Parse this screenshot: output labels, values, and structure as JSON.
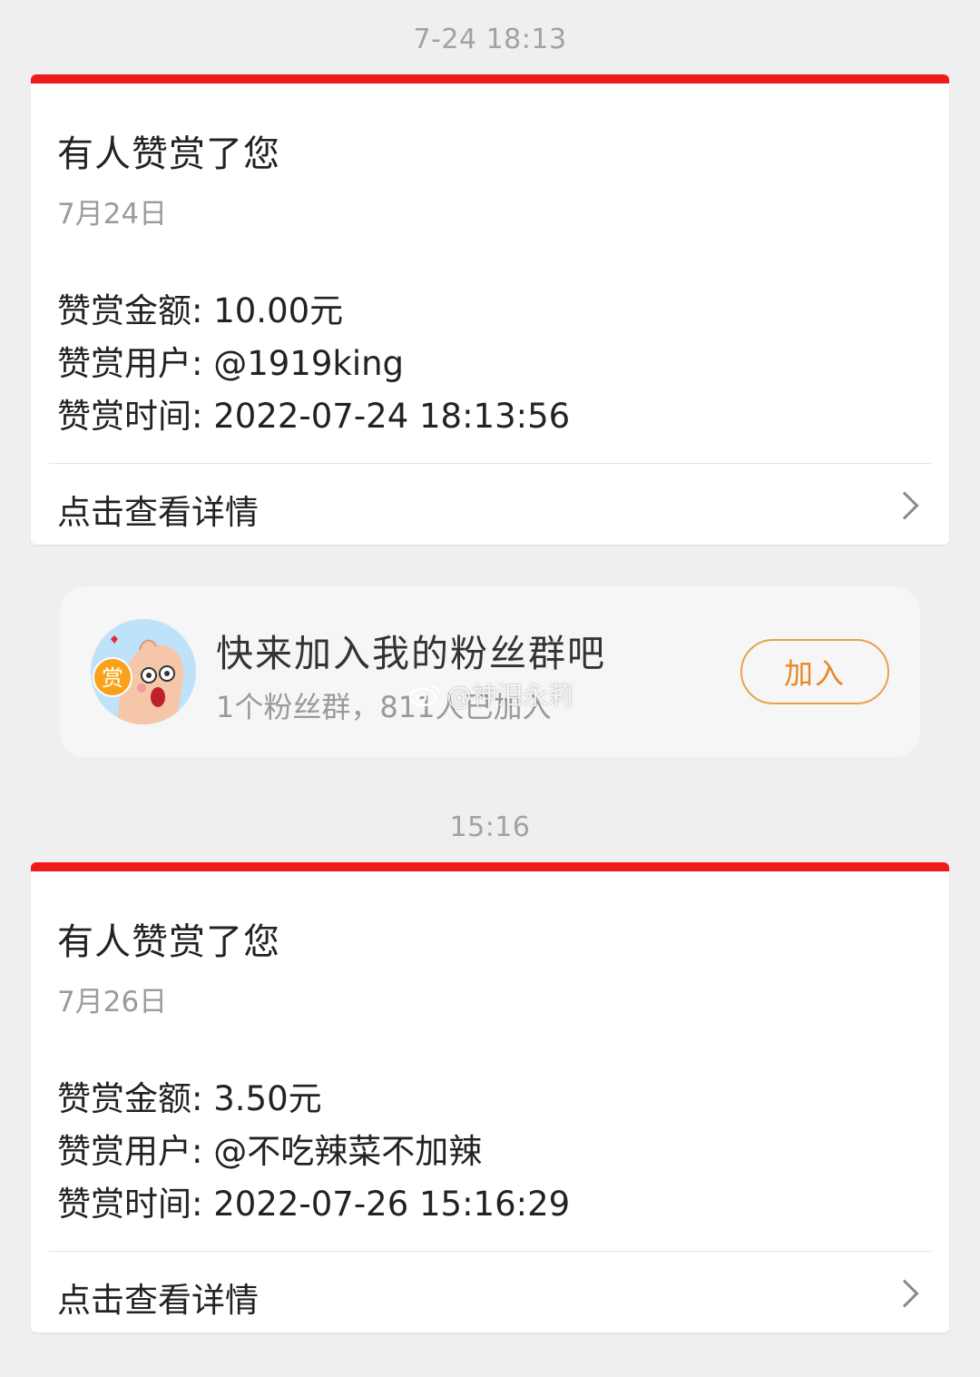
{
  "messages": [
    {
      "timestamp": "7-24 18:13",
      "title": "有人赞赏了您",
      "date": "7月24日",
      "amount_line": "赞赏金额: 10.00元",
      "user_line": "赞赏用户: @1919king",
      "time_line": "赞赏时间: 2022-07-24 18:13:56",
      "footer_label": "点击查看详情"
    },
    {
      "timestamp": "15:16",
      "title": "有人赞赏了您",
      "date": "7月26日",
      "amount_line": "赞赏金额: 3.50元",
      "user_line": "赞赏用户: @不吃辣菜不加辣",
      "time_line": "赞赏时间: 2022-07-26 15:16:29",
      "footer_label": "点击查看详情"
    }
  ],
  "fan_group": {
    "title": "快来加入我的粉丝群吧",
    "subtitle": "1个粉丝群，811人已加入",
    "join_label": "加入",
    "avatar_badge": "赏"
  },
  "watermark": "@神泪永莉",
  "colors": {
    "accent_red": "#ee1b1b",
    "join_orange": "#e5892a",
    "background": "#efefef"
  },
  "icons": [
    "chevron-right-icon",
    "avatar-mascot-icon",
    "weibo-logo-icon"
  ]
}
